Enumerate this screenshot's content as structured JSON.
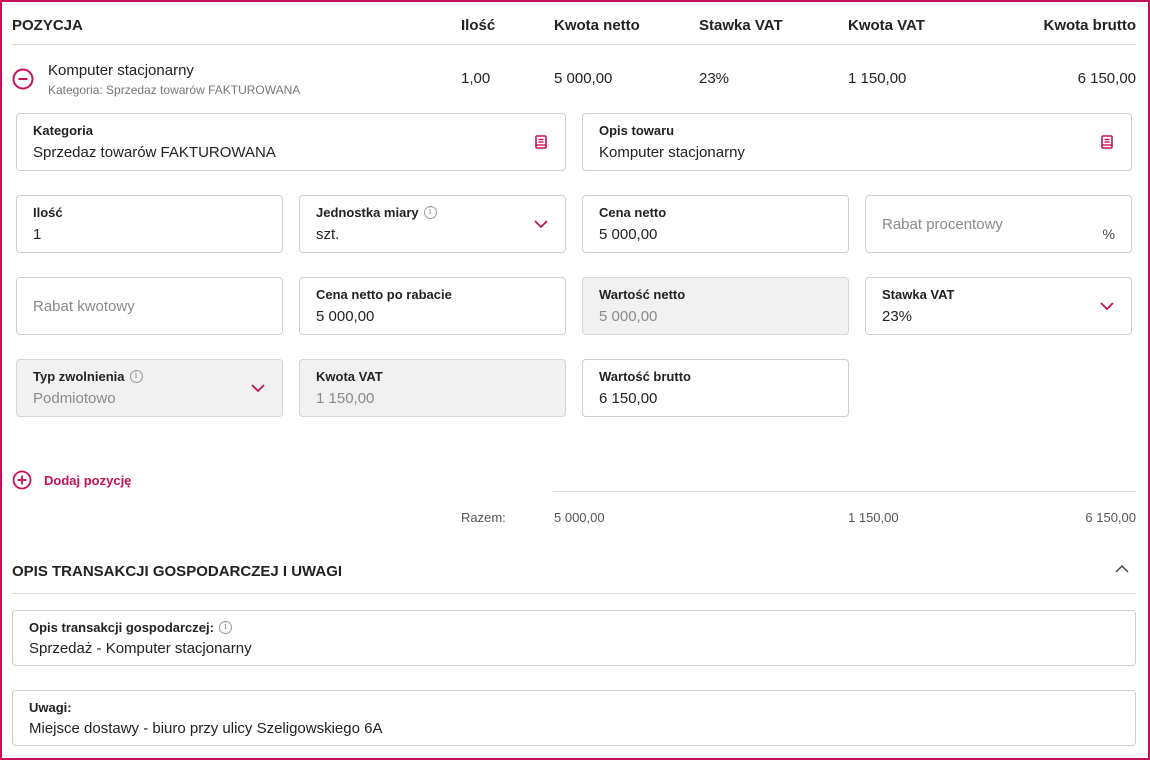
{
  "table": {
    "headers": {
      "position": "POZYCJA",
      "quantity": "Ilość",
      "net_amount": "Kwota netto",
      "vat_rate": "Stawka VAT",
      "vat_amount": "Kwota VAT",
      "gross_amount": "Kwota brutto"
    },
    "item": {
      "name": "Komputer stacjonarny",
      "category_line": "Kategoria: Sprzedaz towarów FAKTUROWANA",
      "quantity": "1,00",
      "net_amount": "5 000,00",
      "vat_rate": "23%",
      "vat_amount": "1 150,00",
      "gross_amount": "6 150,00"
    }
  },
  "form": {
    "category": {
      "label": "Kategoria",
      "value": "Sprzedaz towarów FAKTUROWANA",
      "icon": "book-icon"
    },
    "product_desc": {
      "label": "Opis towaru",
      "value": "Komputer stacjonarny",
      "icon": "book-icon"
    },
    "quantity": {
      "label": "Ilość",
      "value": "1"
    },
    "unit": {
      "label": "Jednostka miary",
      "value": "szt."
    },
    "net_price": {
      "label": "Cena netto",
      "value": "5 000,00"
    },
    "discount_percent": {
      "placeholder": "Rabat procentowy",
      "suffix": "%"
    },
    "discount_amount": {
      "placeholder": "Rabat kwotowy"
    },
    "net_after_discount": {
      "label": "Cena netto po rabacie",
      "value": "5 000,00"
    },
    "net_value": {
      "label": "Wartość netto",
      "value": "5 000,00"
    },
    "vat_rate": {
      "label": "Stawka VAT",
      "value": "23%"
    },
    "exemption_type": {
      "label": "Typ zwolnienia",
      "value": "Podmiotowo"
    },
    "vat_amount": {
      "label": "Kwota VAT",
      "value": "1 150,00"
    },
    "gross_value": {
      "label": "Wartość brutto",
      "value": "6 150,00"
    }
  },
  "add_position": {
    "label": "Dodaj pozycję"
  },
  "totals": {
    "label": "Razem:",
    "net": "5 000,00",
    "vat": "1 150,00",
    "gross": "6 150,00"
  },
  "section": {
    "title": "OPIS TRANSAKCJI GOSPODARCZEJ I UWAGI",
    "transaction_desc": {
      "label": "Opis transakcji gospodarczej:",
      "value": "Sprzedaż - Komputer stacjonarny"
    },
    "notes": {
      "label": "Uwagi:",
      "value": "Miejsce dostawy - biuro przy ulicy Szeligowskiego 6A"
    }
  },
  "colors": {
    "accent": "#c8105a",
    "border": "#cfcfcf",
    "disabled_bg": "#f1f1f1"
  }
}
